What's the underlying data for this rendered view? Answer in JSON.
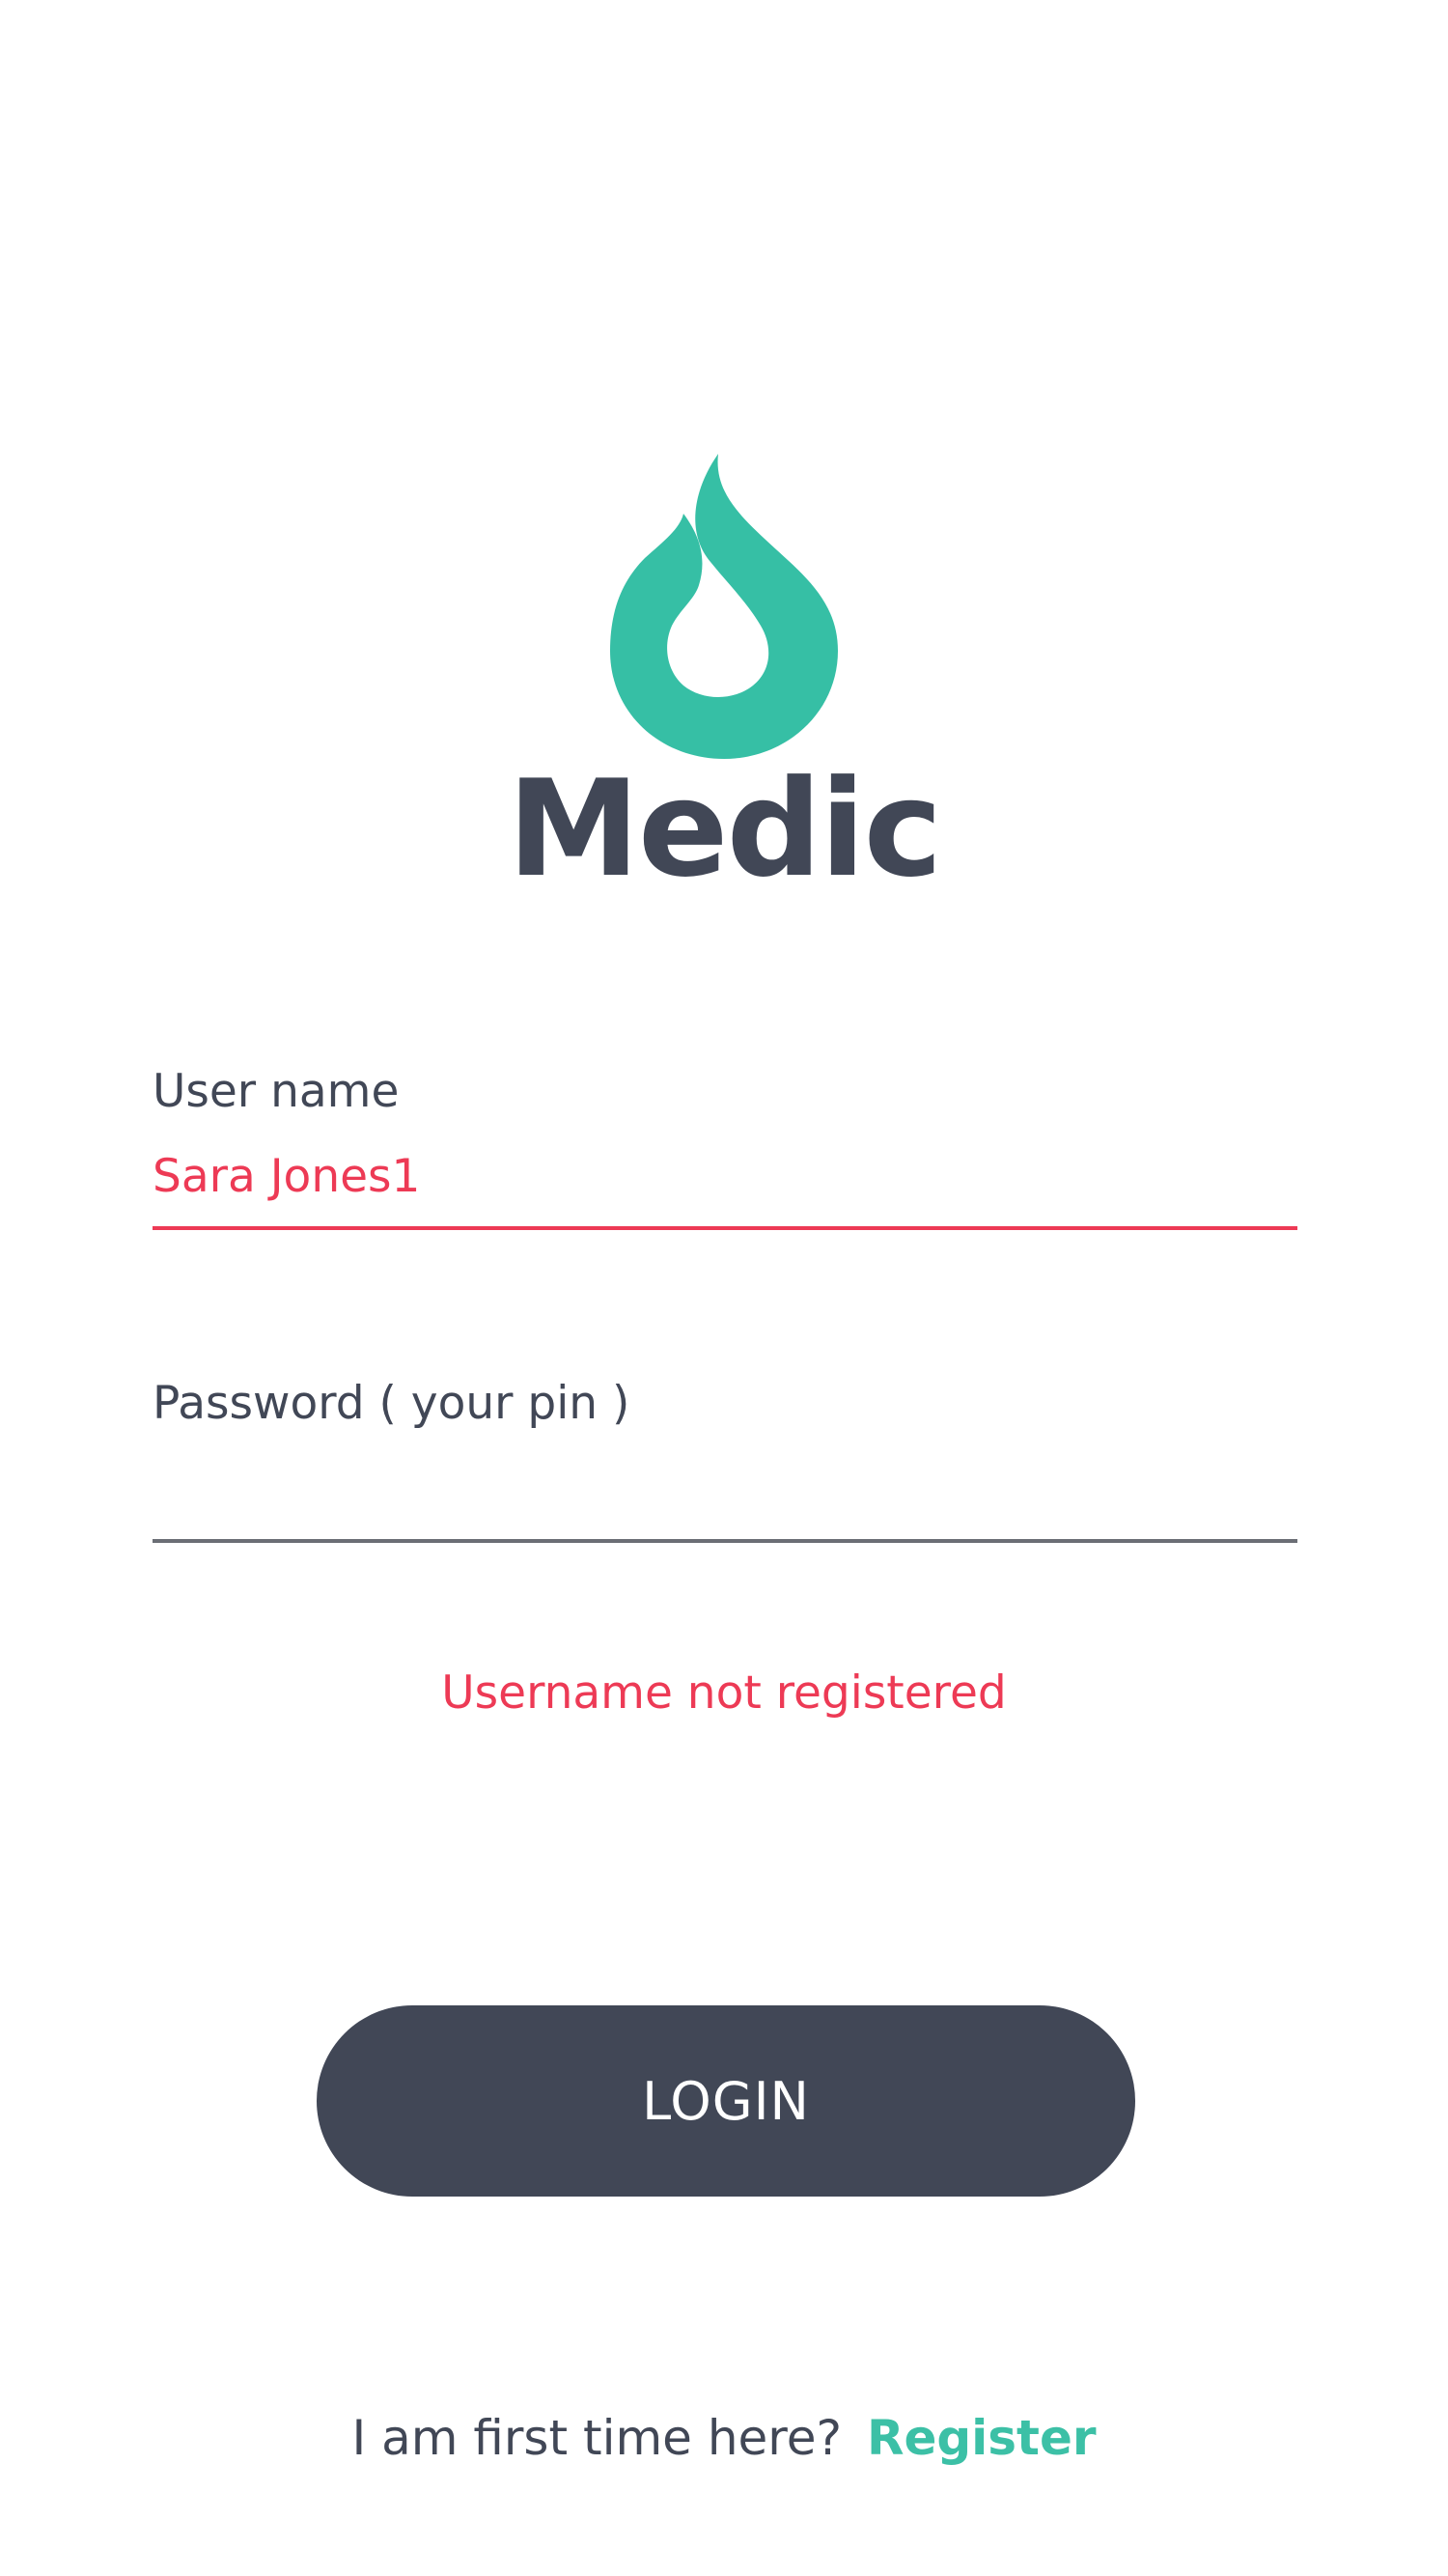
{
  "app": {
    "name": "Medic",
    "logo_icon": "droplet-flame-icon",
    "brand_color": "#36bfa5",
    "text_color": "#414756"
  },
  "login_form": {
    "username_label": "User name",
    "username_value": "Sara Jones1",
    "password_label": "Password ( your pin )",
    "password_value": "",
    "error_message": "Username not registered",
    "error_color": "#ed3a55",
    "login_button_label": "LOGIN"
  },
  "footer": {
    "prompt_text": "I am first time here?",
    "register_link_label": "Register",
    "link_color": "#3cc0a6"
  }
}
